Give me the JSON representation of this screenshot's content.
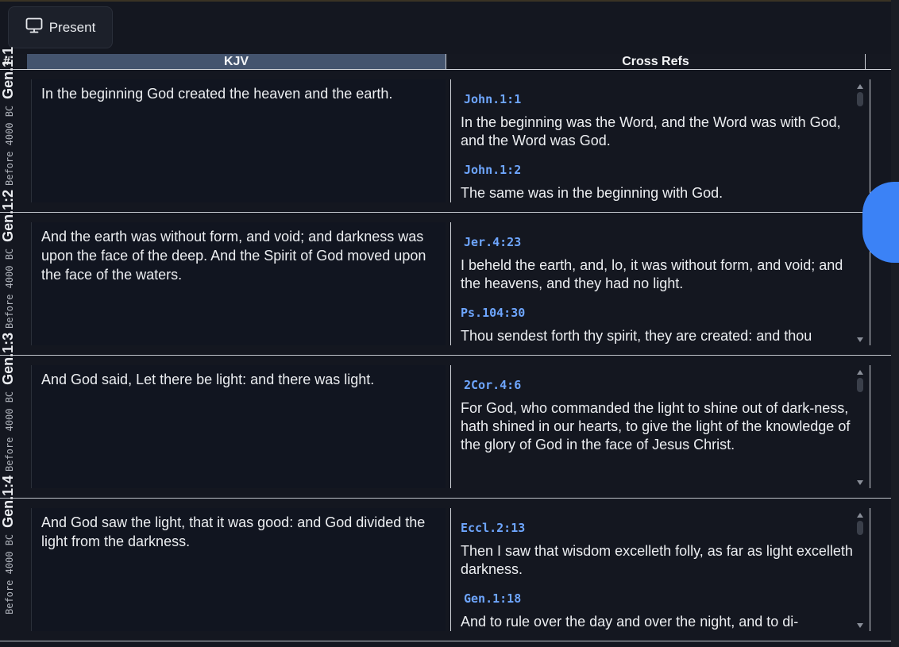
{
  "toolbar": {
    "present_label": "Present",
    "present_icon": "monitor-icon"
  },
  "columns": {
    "hash": "#",
    "kjv": "KJV",
    "xrefs": "Cross Refs"
  },
  "rows": [
    {
      "ref": "Gen.1:1",
      "era": "Before 4000 BC",
      "text": "In the beginning God created the heaven and the earth.",
      "xrefs": [
        {
          "ref": "John.1:1",
          "text": "In the beginning was the Word, and the Word was with God, and the Word was God."
        },
        {
          "ref": "John.1:2",
          "text": "The same was in the beginning with God."
        }
      ]
    },
    {
      "ref": "Gen.1:2",
      "era": "Before 4000 BC",
      "text": "And the earth was without form, and void; and darkness was upon the face of the deep. And the Spirit of God moved upon the face of the waters.",
      "xrefs": [
        {
          "ref": "Jer.4:23",
          "text": "I beheld the earth, and, lo, it was without form, and void; and the heavens, and they had no light."
        },
        {
          "ref": "Ps.104:30",
          "text": "Thou sendest forth thy spirit, they are created: and thou"
        }
      ]
    },
    {
      "ref": "Gen.1:3",
      "era": "Before 4000 BC",
      "text": "And God said, Let there be light: and there was light.",
      "xrefs": [
        {
          "ref": "2Cor.4:6",
          "text": "For God, who commanded the light to shine out of dark-ness, hath shined in our hearts, to give the light of the knowledge of the glory of God in the face of Jesus Christ."
        }
      ]
    },
    {
      "ref": "Gen.1:4",
      "era": "Before 4000 BC",
      "text": "And God saw the light, that it was good: and God divided the light from the darkness.",
      "xrefs": [
        {
          "ref": "Eccl.2:13",
          "text": "Then I saw that wisdom excelleth folly, as far as light excelleth darkness."
        },
        {
          "ref": "Gen.1:18",
          "text": "And to rule over the day and over the night, and to di-"
        }
      ]
    }
  ],
  "colors": {
    "accent": "#3b82f6",
    "ref_link": "#6ea6ff",
    "header_kjv": "#44546e"
  }
}
